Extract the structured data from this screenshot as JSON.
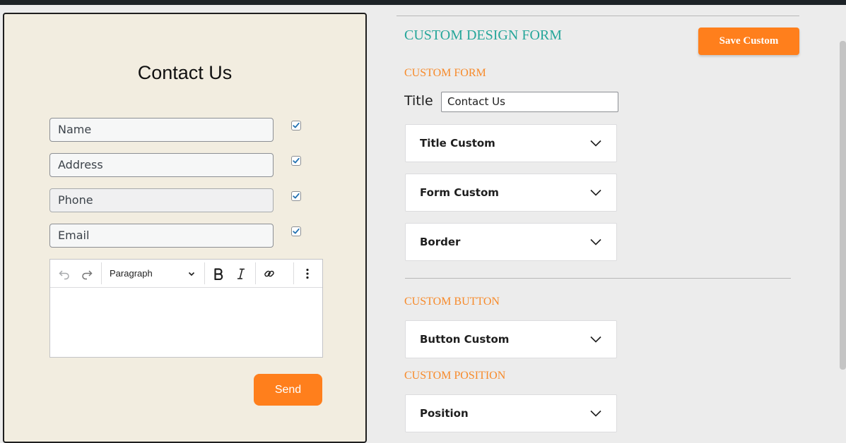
{
  "preview": {
    "title": "Contact Us",
    "fields": [
      {
        "placeholder": "Name",
        "checked": true
      },
      {
        "placeholder": "Address",
        "checked": true
      },
      {
        "placeholder": "Phone",
        "checked": true
      },
      {
        "placeholder": "Email",
        "checked": true
      }
    ],
    "editor": {
      "block_type": "Paragraph"
    },
    "send_label": "Send"
  },
  "settings": {
    "heading": "CUSTOM DESIGN FORM",
    "save_label": "Save Custom",
    "form_section": {
      "label": "CUSTOM FORM",
      "title_label": "Title",
      "title_value": "Contact Us",
      "panels": [
        "Title Custom",
        "Form Custom",
        "Border"
      ]
    },
    "button_section": {
      "label": "CUSTOM BUTTON",
      "panels": [
        "Button Custom"
      ]
    },
    "position_section": {
      "label": "CUSTOM POSITION",
      "panels": [
        "Position"
      ]
    }
  },
  "colors": {
    "accent_orange": "#ff7f1c",
    "heading_teal": "#26a69a",
    "section_orange": "#f78a2a",
    "preview_bg": "#f2ede0"
  },
  "icons": [
    "checkbox-checked-icon",
    "undo-icon",
    "redo-icon",
    "chevron-down-icon",
    "bold-icon",
    "italic-icon",
    "link-icon",
    "more-vertical-icon"
  ]
}
